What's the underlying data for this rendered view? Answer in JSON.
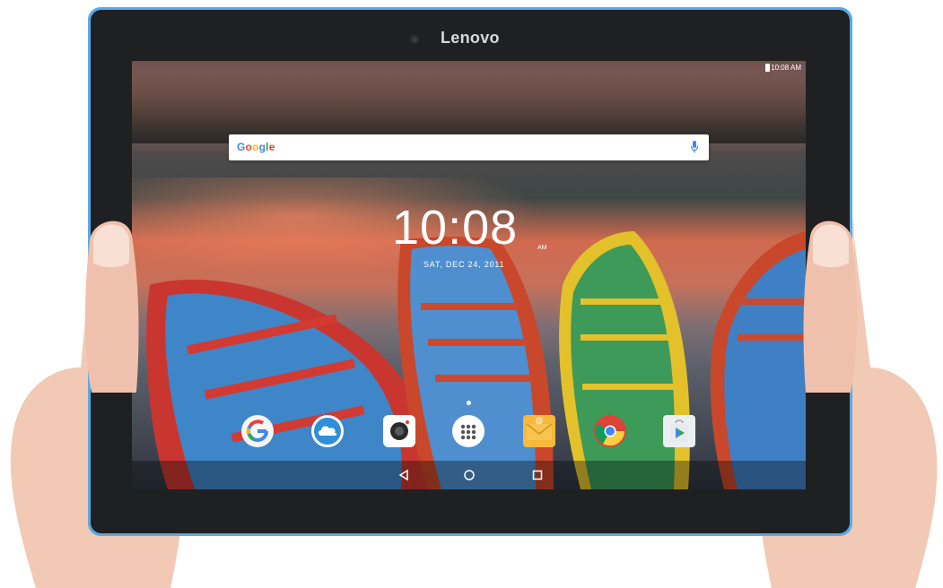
{
  "device": {
    "brand": "Lenovo",
    "bezel_color": "#1e2022",
    "frame_color": "#5aa9e6"
  },
  "status_bar": {
    "time": "10:08 AM",
    "battery_icon": "battery-icon"
  },
  "search": {
    "logo_letters": [
      "G",
      "o",
      "o",
      "g",
      "l",
      "e"
    ],
    "mic_icon": "mic-icon"
  },
  "clock_widget": {
    "time": "10:08",
    "ampm": "AM",
    "date": "SAT, DEC 24, 2011"
  },
  "dock": {
    "apps": [
      {
        "name": "google-app",
        "icon": "google-icon"
      },
      {
        "name": "cloud-app",
        "icon": "cloud-icon"
      },
      {
        "name": "camera-app",
        "icon": "camera-icon"
      },
      {
        "name": "app-drawer",
        "icon": "apps-grid-icon"
      },
      {
        "name": "email-app",
        "icon": "email-icon"
      },
      {
        "name": "chrome-app",
        "icon": "chrome-icon"
      },
      {
        "name": "play-store-app",
        "icon": "play-store-icon"
      }
    ]
  },
  "nav_bar": {
    "buttons": [
      "back-icon",
      "home-icon",
      "recents-icon"
    ]
  }
}
